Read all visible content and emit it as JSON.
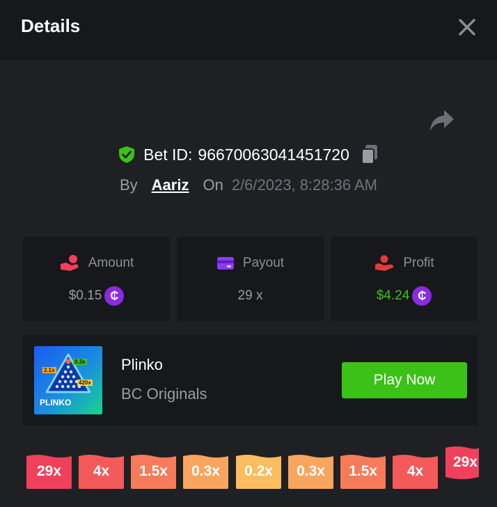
{
  "header": {
    "title": "Details"
  },
  "bet": {
    "prefix": "Bet ID:",
    "id": "96670063041451720",
    "by_label": "By",
    "user": "Aariz",
    "on_label": "On",
    "datetime": "2/6/2023, 8:28:36 AM"
  },
  "cards": [
    {
      "label": "Amount",
      "value": "$0.15",
      "coin": "₵",
      "icon": "money-hand-icon"
    },
    {
      "label": "Payout",
      "value": "29 x",
      "icon": "wallet-card-icon"
    },
    {
      "label": "Profit",
      "value": "$4.24",
      "coin": "₵",
      "icon": "profit-hand-icon"
    }
  ],
  "game": {
    "name": "Plinko",
    "provider": "BC Originals",
    "play_label": "Play Now",
    "thumb_text": "PLINKO",
    "thumb_tags": [
      "2.1x",
      "0.3x",
      "420x"
    ]
  },
  "multipliers": [
    "29x",
    "4x",
    "1.5x",
    "0.3x",
    "0.2x",
    "0.3x",
    "1.5x",
    "4x",
    "29x"
  ],
  "colors": {
    "accent_green": "#3bc117",
    "profit_green": "#3bc117",
    "coin_purple": "#8a2be2",
    "multiplier_colors": [
      "#f1405b",
      "#f35a59",
      "#f57b5b",
      "#f8a55f",
      "#fbbd60",
      "#f8a55f",
      "#f57b5b",
      "#f35a59",
      "#f1405b"
    ]
  }
}
